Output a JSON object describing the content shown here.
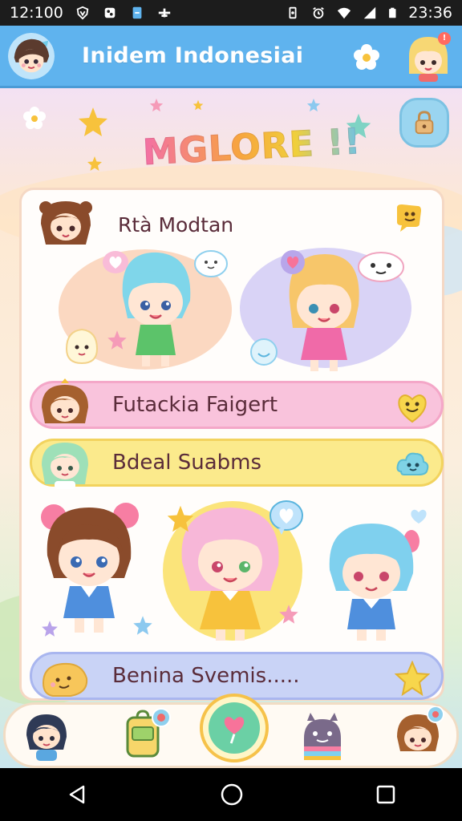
{
  "status_bar": {
    "time_left": "12:100",
    "time_right": "23:36"
  },
  "app_bar": {
    "title": "Inidem Indonesiai",
    "notification_count": "!"
  },
  "hero": {
    "title": "MGLORE !!"
  },
  "card": {
    "header_title": "Rtà Modtan",
    "pills": [
      {
        "label": "Futackia Faigert"
      },
      {
        "label": "Bdeal Suabms"
      },
      {
        "label": "Benina Svemis....."
      }
    ]
  },
  "colors": {
    "app_bar": "#5fb3ee",
    "pill_pink": "#f9c3dc",
    "pill_yellow": "#fbea8c",
    "pill_blue": "#c9d3f6",
    "nav_center": "#6bd0a5"
  }
}
